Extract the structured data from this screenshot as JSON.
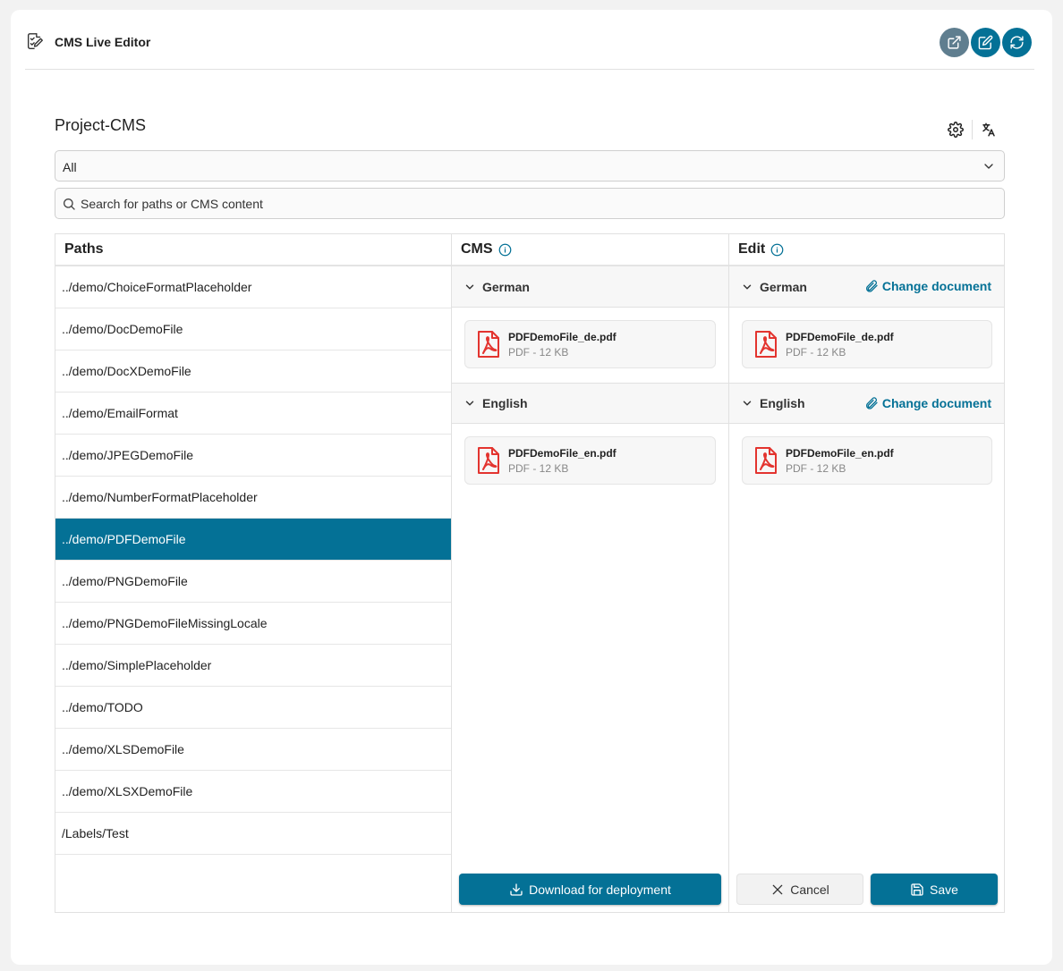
{
  "app": {
    "title": "CMS Live Editor"
  },
  "header_actions": [
    {
      "icon": "external-link-icon"
    },
    {
      "icon": "edit-icon"
    },
    {
      "icon": "refresh-icon"
    }
  ],
  "project": {
    "title": "Project-CMS"
  },
  "filter": {
    "value": "All"
  },
  "search": {
    "placeholder": "Search for paths or CMS content",
    "value": ""
  },
  "columns": {
    "paths": "Paths",
    "cms": "CMS",
    "edit": "Edit"
  },
  "paths": [
    "../demo/ChoiceFormatPlaceholder",
    "../demo/DocDemoFile",
    "../demo/DocXDemoFile",
    "../demo/EmailFormat",
    "../demo/JPEGDemoFile",
    "../demo/NumberFormatPlaceholder",
    "../demo/PDFDemoFile",
    "../demo/PNGDemoFile",
    "../demo/PNGDemoFileMissingLocale",
    "../demo/SimplePlaceholder",
    "../demo/TODO",
    "../demo/XLSDemoFile",
    "../demo/XLSXDemoFile",
    "/Labels/Test"
  ],
  "selected_path_index": 6,
  "cms": {
    "languages": [
      {
        "name": "German",
        "file": {
          "name": "PDFDemoFile_de.pdf",
          "meta": "PDF - 12 KB"
        }
      },
      {
        "name": "English",
        "file": {
          "name": "PDFDemoFile_en.pdf",
          "meta": "PDF - 12 KB"
        }
      }
    ],
    "download_label": "Download for deployment"
  },
  "edit": {
    "change_document_label": "Change document",
    "languages": [
      {
        "name": "German",
        "file": {
          "name": "PDFDemoFile_de.pdf",
          "meta": "PDF - 12 KB"
        }
      },
      {
        "name": "English",
        "file": {
          "name": "PDFDemoFile_en.pdf",
          "meta": "PDF - 12 KB"
        }
      }
    ],
    "cancel_label": "Cancel",
    "save_label": "Save"
  },
  "colors": {
    "accent": "#047196",
    "accent_grey": "#5f7e8f",
    "pdf_red": "#e3342f"
  }
}
